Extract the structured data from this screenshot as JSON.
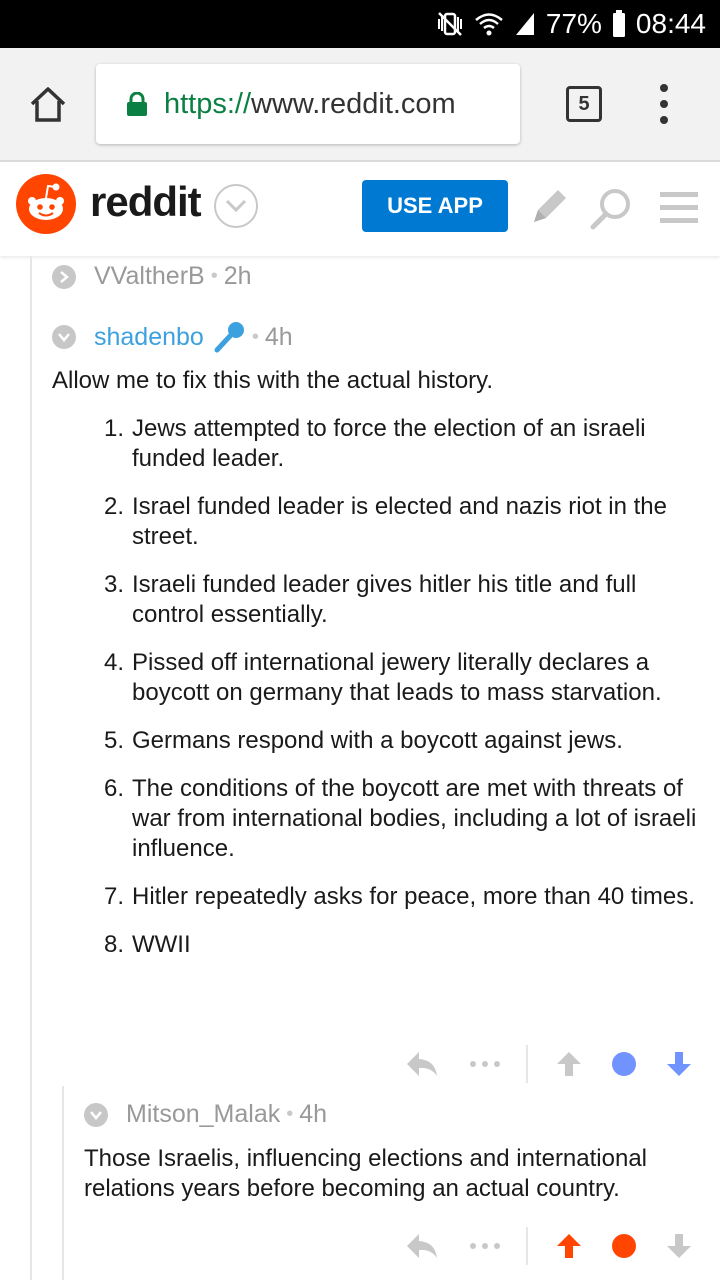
{
  "status_bar": {
    "battery": "77%",
    "time": "08:44",
    "icons": [
      "mute-vibrate-icon",
      "wifi-icon",
      "signal-icon",
      "battery-icon"
    ]
  },
  "browser": {
    "url_scheme": "https://",
    "url_host": "www.reddit.com",
    "tab_count": "5",
    "icons": [
      "home-icon",
      "lock-icon",
      "overflow-menu-icon"
    ]
  },
  "header": {
    "brand": "reddit",
    "use_app_label": "USE APP",
    "brand_color": "#ff4500",
    "button_color": "#0079d3",
    "icons": [
      "snoo-logo-icon",
      "chevron-down-icon",
      "pencil-icon",
      "search-icon",
      "hamburger-menu-icon"
    ]
  },
  "comments": [
    {
      "username": "VValtherB",
      "time": "2h",
      "collapsed": true
    },
    {
      "username": "shadenbo",
      "time": "4h",
      "flair_icon": "microphone-icon",
      "intro": "Allow me to fix this with the actual history.",
      "items": [
        {
          "num": "1.",
          "text": "Jews attempted to force the election of an israeli funded leader."
        },
        {
          "num": "2.",
          "text": "Israel funded leader is elected and nazis riot in the street."
        },
        {
          "num": "3.",
          "text": "Israeli funded leader gives hitler his title and full control essentially."
        },
        {
          "num": "4.",
          "text": "Pissed off international jewery literally declares a boycott on germany that leads to mass starvation."
        },
        {
          "num": "5.",
          "text": "Germans respond with a boycott against jews."
        },
        {
          "num": "6.",
          "text": "The conditions of the boycott are met with threats of war from international bodies, including a lot of israeli influence."
        },
        {
          "num": "7.",
          "text": "Hitler repeatedly asks for peace, more than 40 times."
        },
        {
          "num": "8.",
          "text": "WWII"
        }
      ],
      "vote_state": "downvoted",
      "vote_color": "#7193ff"
    },
    {
      "username": "Mitson_Malak",
      "time": "4h",
      "body": "Those Israelis, influencing elections and international relations years before becoming an actual country.",
      "vote_state": "upvoted",
      "vote_color": "#ff4500"
    }
  ]
}
